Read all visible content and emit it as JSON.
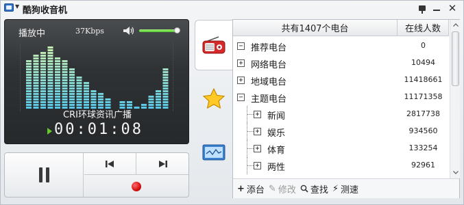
{
  "window": {
    "title": "酷狗收音机"
  },
  "player": {
    "status": "播放中",
    "bitrate": "37Kbps",
    "volume_percent": 100,
    "station": "CRI环球资讯广播",
    "time": "00:01:08",
    "accent_color": "#62c82c",
    "spectrum_levels": [
      0.72,
      0.8,
      0.86,
      0.93,
      0.78,
      0.74,
      0.62,
      0.5,
      0.4,
      0.3,
      0.26,
      0.16,
      0.0,
      0.14,
      0.12,
      0.04,
      0.1,
      0.2,
      0.3,
      0.62
    ]
  },
  "controls": {
    "pause_icon": "pause-icon",
    "prev_icon": "previous-track-icon",
    "next_icon": "next-track-icon",
    "record_icon": "record-icon"
  },
  "tabs": [
    {
      "name": "radio",
      "icon": "radio-icon"
    },
    {
      "name": "favorites",
      "icon": "star-icon"
    },
    {
      "name": "screen",
      "icon": "monitor-icon"
    }
  ],
  "list": {
    "header_name": "共有1407个电台",
    "header_count": "在线人数",
    "rows": [
      {
        "label": "推荐电台",
        "count": "0",
        "level": 0,
        "expander": "−"
      },
      {
        "label": "网络电台",
        "count": "10494",
        "level": 0,
        "expander": "+"
      },
      {
        "label": "地域电台",
        "count": "11418661",
        "level": 0,
        "expander": "+"
      },
      {
        "label": "主题电台",
        "count": "11171358",
        "level": 0,
        "expander": "−"
      },
      {
        "label": "新闻",
        "count": "2817738",
        "level": 1,
        "expander": "+"
      },
      {
        "label": "娱乐",
        "count": "934560",
        "level": 1,
        "expander": "+"
      },
      {
        "label": "体育",
        "count": "133254",
        "level": 1,
        "expander": "+"
      },
      {
        "label": "两性",
        "count": "92961",
        "level": 1,
        "expander": "+"
      }
    ]
  },
  "toolbar": {
    "add_label": "添台",
    "edit_label": "修改",
    "find_label": "查找",
    "speed_label": "测速"
  }
}
